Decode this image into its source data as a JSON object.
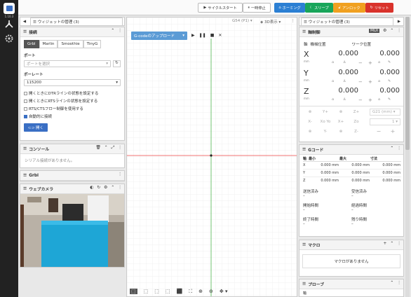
{
  "app": {
    "version": "1.10.3"
  },
  "workspace_tabs": {
    "left": "ウィジェットの管理 (3)",
    "right": "ウィジェットの管理 (3)"
  },
  "header": {
    "cycle_start": "サイクルスタート",
    "pause": "一時停止",
    "home": "ホーミング",
    "sleep": "スリープ",
    "unlock": "アンロック",
    "reset": "リセット"
  },
  "connection": {
    "title": "接続",
    "controllers": [
      "Grbl",
      "Marlin",
      "Smoothie",
      "TinyG"
    ],
    "port_label": "ポート",
    "port_placeholder": "ポートを選択",
    "baud_label": "ボーレート",
    "baud_value": "115200",
    "options": [
      {
        "label": "開くときにDTRラインの状態を設定する",
        "checked": false
      },
      {
        "label": "開くときにRTSラインの状態を設定する",
        "checked": false
      },
      {
        "label": "RTS/CTSフロー制御を使用する",
        "checked": false
      },
      {
        "label": "自動的に接続",
        "checked": true
      }
    ],
    "open_button": "開く"
  },
  "console": {
    "title": "コンソール",
    "empty": "シリアル接続がありません。"
  },
  "grbl": {
    "title": "Grbl"
  },
  "webcam": {
    "title": "ウェブカメラ"
  },
  "visualizer": {
    "upload": "G-codeのアップロード",
    "wcs": "G54 (P1)",
    "view": "3D表示"
  },
  "axes": {
    "title": "軸制御",
    "mdi": "MDI",
    "col_axis": "軸",
    "col_machine": "機械位置",
    "col_work": "ワーク位置",
    "rows": [
      {
        "axis": "X",
        "unit": "mm",
        "machine": "0.000",
        "work": "0.000"
      },
      {
        "axis": "Y",
        "unit": "mm",
        "machine": "0.000",
        "work": "0.000"
      },
      {
        "axis": "Z",
        "unit": "mm",
        "machine": "0.000",
        "work": "0.000"
      }
    ],
    "jog": [
      "Y+",
      "Z+",
      "X-",
      "Xo Yo",
      "X+",
      "Zo",
      "Y-",
      "Z-"
    ],
    "units": "G21 (mm)",
    "jog_step": "1",
    "minus": "−",
    "plus": "+"
  },
  "gcode": {
    "title": "Gコード",
    "columns": [
      "軸",
      "最小",
      "最大",
      "寸法"
    ],
    "rows": [
      {
        "axis": "X",
        "min": "0.000 mm",
        "max": "0.000 mm",
        "dim": "0.000 mm"
      },
      {
        "axis": "Y",
        "min": "0.000 mm",
        "max": "0.000 mm",
        "dim": "0.000 mm"
      },
      {
        "axis": "Z",
        "min": "0.000 mm",
        "max": "0.000 mm",
        "dim": "0.000 mm"
      }
    ],
    "stats": [
      {
        "label": "送信済み",
        "value": "–"
      },
      {
        "label": "受信済み",
        "value": "–"
      },
      {
        "label": "開始時間",
        "value": "–"
      },
      {
        "label": "経過時間",
        "value": "–"
      },
      {
        "label": "終了時間",
        "value": "–"
      },
      {
        "label": "残り時間",
        "value": "–"
      }
    ]
  },
  "macro": {
    "title": "マクロ",
    "empty": "マクロがありません"
  },
  "probe": {
    "title": "プローブ",
    "axis_label": "軸"
  },
  "colors": {
    "home": "#2b7fd3",
    "sleep": "#19a55a",
    "unlock": "#f0a020",
    "reset": "#d9322b",
    "accent": "#3a6fc4"
  }
}
